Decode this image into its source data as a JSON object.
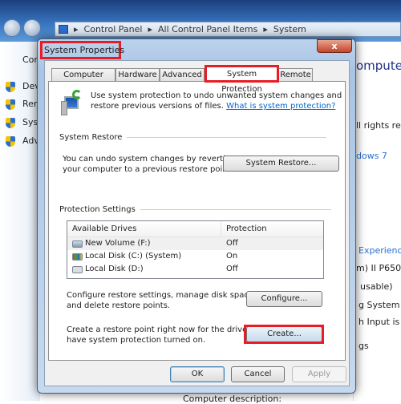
{
  "explorer": {
    "breadcrumb": [
      "Control Panel",
      "All Control Panel Items",
      "System"
    ],
    "sidebar_fragments": [
      "Con",
      "Dev",
      "Rem",
      "Syst",
      "Adv"
    ],
    "right_fragments": [
      "omputer",
      "ll rights res",
      "dows 7",
      "Experience",
      "m) II P650",
      "usable)",
      "g System",
      "h Input is a",
      "gs"
    ],
    "bottom_fragment": "Computer description:"
  },
  "dialog": {
    "title": "System Properties",
    "close_label": "x",
    "tabs": [
      "Computer Name",
      "Hardware",
      "Advanced",
      "System Protection",
      "Remote"
    ],
    "active_tab": "System Protection",
    "intro": {
      "line1": "Use system protection to undo unwanted system changes and",
      "line2": "restore previous versions of files.",
      "link": "What is system protection?"
    },
    "system_restore": {
      "heading": "System Restore",
      "line1": "You can undo system changes by reverting",
      "line2": "your computer to a previous restore point.",
      "button": "System Restore..."
    },
    "protection": {
      "heading": "Protection Settings",
      "columns": [
        "Available Drives",
        "Protection"
      ],
      "drives": [
        {
          "name": "New Volume (F:)",
          "protection": "Off"
        },
        {
          "name": "Local Disk (C:) (System)",
          "protection": "On"
        },
        {
          "name": "Local Disk (D:)",
          "protection": "Off"
        }
      ]
    },
    "configure": {
      "line1": "Configure restore settings, manage disk space,",
      "line2": "and delete restore points.",
      "button": "Configure..."
    },
    "create": {
      "line1": "Create a restore point right now for the drives that",
      "line2": "have system protection turned on.",
      "button": "Create..."
    },
    "footer": {
      "ok": "OK",
      "cancel": "Cancel",
      "apply": "Apply"
    },
    "highlight_color": "#e81c24"
  }
}
